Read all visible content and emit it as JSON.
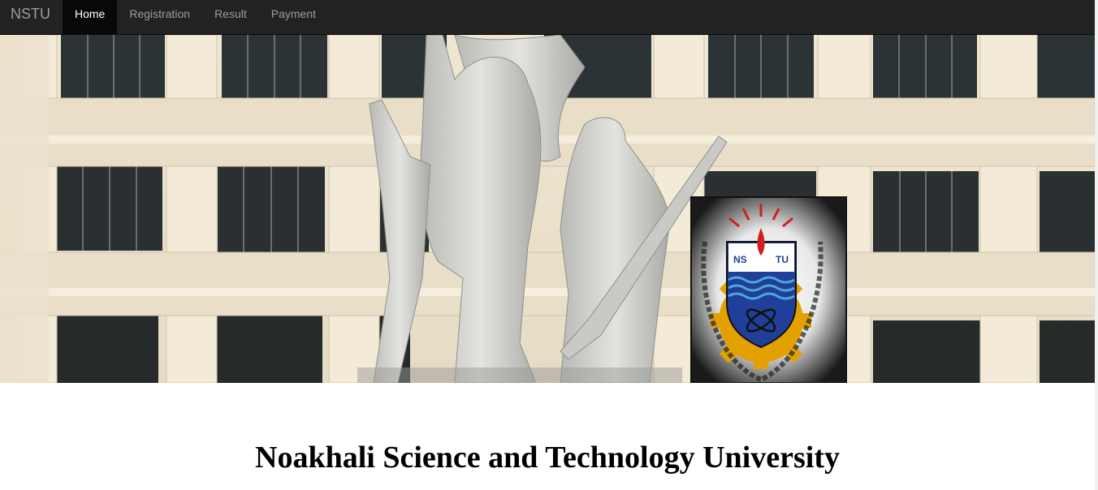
{
  "navbar": {
    "brand": "NSTU",
    "items": [
      {
        "label": "Home",
        "active": true
      },
      {
        "label": "Registration",
        "active": false
      },
      {
        "label": "Result",
        "active": false
      },
      {
        "label": "Payment",
        "active": false
      }
    ]
  },
  "hero": {
    "logo_letters_left": "NS",
    "logo_letters_right": "TU"
  },
  "main": {
    "title": "Noakhali Science and Technology University"
  },
  "colors": {
    "navbar_bg": "#222222",
    "navbar_active_bg": "#080808",
    "navbar_text": "#9d9d9d",
    "navbar_active_text": "#ffffff"
  }
}
